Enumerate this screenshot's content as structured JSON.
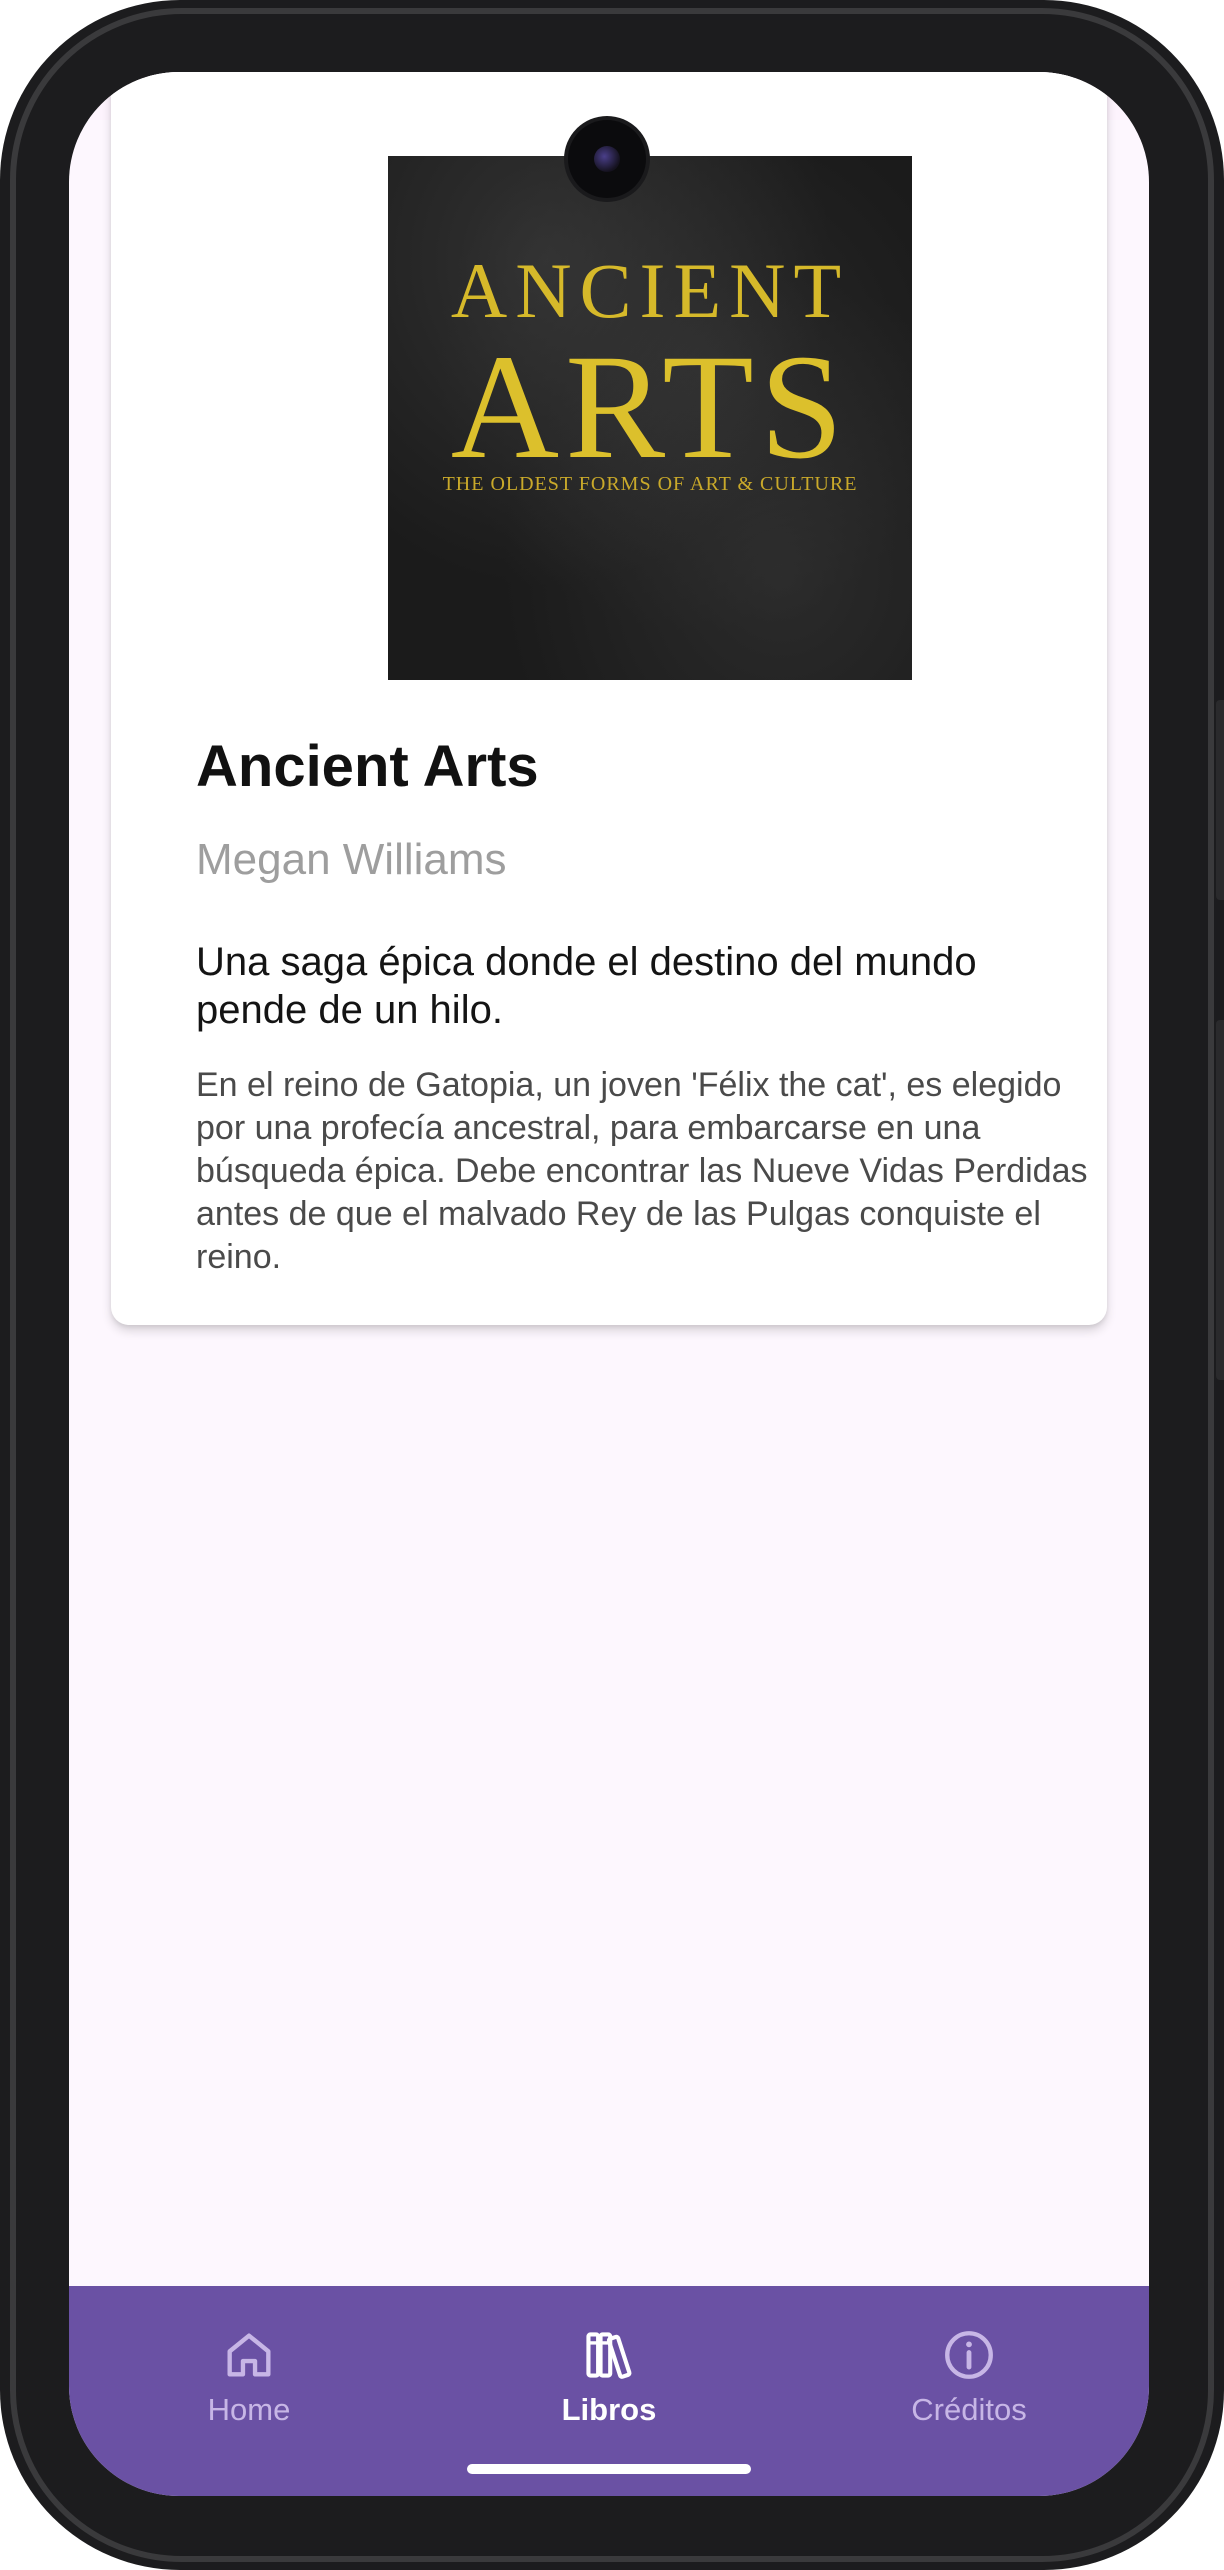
{
  "book": {
    "cover": {
      "line1": "ANCIENT",
      "line2": "ARTS",
      "line3": "THE OLDEST FORMS OF ART & CULTURE"
    },
    "title": "Ancient Arts",
    "author": "Megan Williams",
    "tagline": "Una saga épica donde el destino del mundo pende de un hilo.",
    "description": "En el reino de Gatopia, un joven 'Félix the cat', es elegido por una profecía ancestral, para embarcarse en una búsqueda épica. Debe encontrar las Nueve Vidas Perdidas antes de que el malvado Rey de las Pulgas conquiste el reino."
  },
  "bottom_nav": {
    "items": [
      {
        "label": "Home",
        "icon": "home-icon",
        "active": false
      },
      {
        "label": "Libros",
        "icon": "books-icon",
        "active": true
      },
      {
        "label": "Créditos",
        "icon": "info-icon",
        "active": false
      }
    ]
  },
  "colors": {
    "nav_background": "#6a51a4",
    "nav_inactive": "#c7b6e6",
    "nav_active": "#ffffff",
    "screen_background": "#fdf7fe",
    "cover_text": "#d6b92a"
  }
}
